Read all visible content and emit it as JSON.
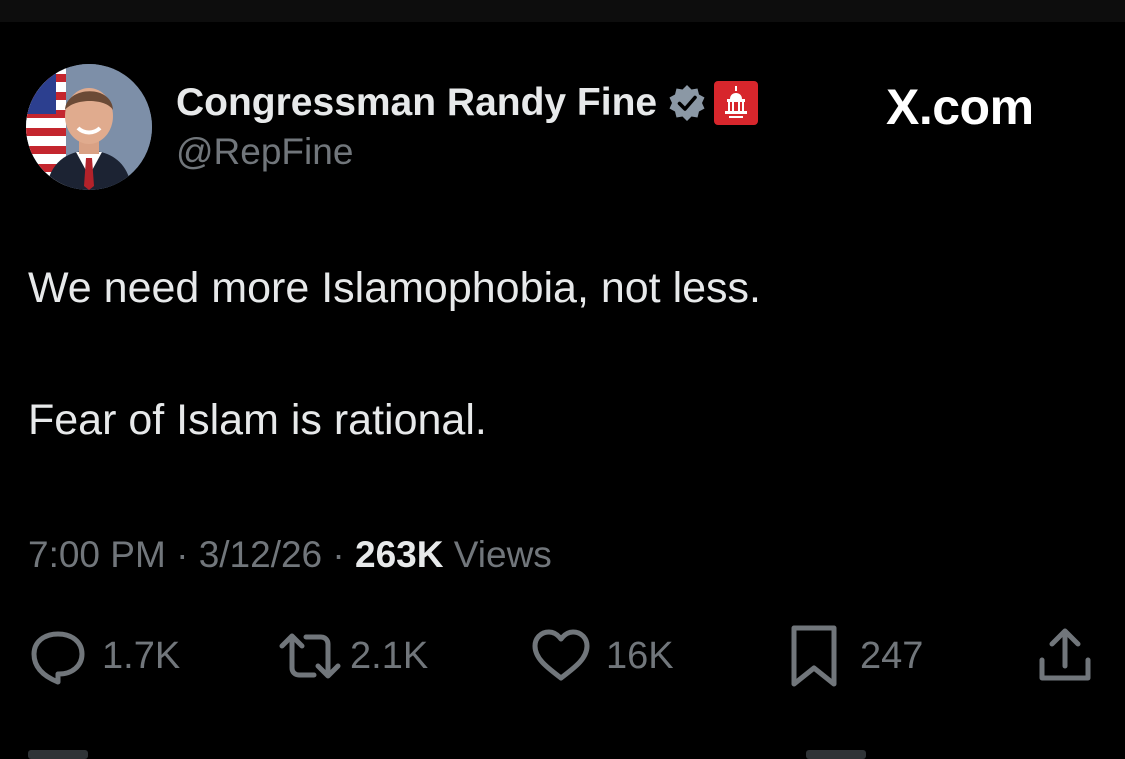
{
  "author": {
    "name": "Congressman Randy Fine",
    "handle": "@RepFine",
    "verified_icon": "verified-badge-icon",
    "affiliation_icon": "house-gop-badge-icon"
  },
  "brand": "X.com",
  "tweet": {
    "lines": [
      "We need more Islamophobia, not less.",
      "Fear of Islam is rational."
    ]
  },
  "meta": {
    "time": "7:00 PM",
    "separator": " · ",
    "date": "3/12/26",
    "views_count": "263K",
    "views_label": " Views"
  },
  "actions": {
    "replies": "1.7K",
    "reposts": "2.1K",
    "likes": "16K",
    "bookmarks": "247"
  },
  "colors": {
    "background": "#000000",
    "text": "#e7e9ea",
    "secondary_text": "#71767b",
    "gop_red": "#d7262c",
    "verified_gray": "#8b98a5"
  }
}
